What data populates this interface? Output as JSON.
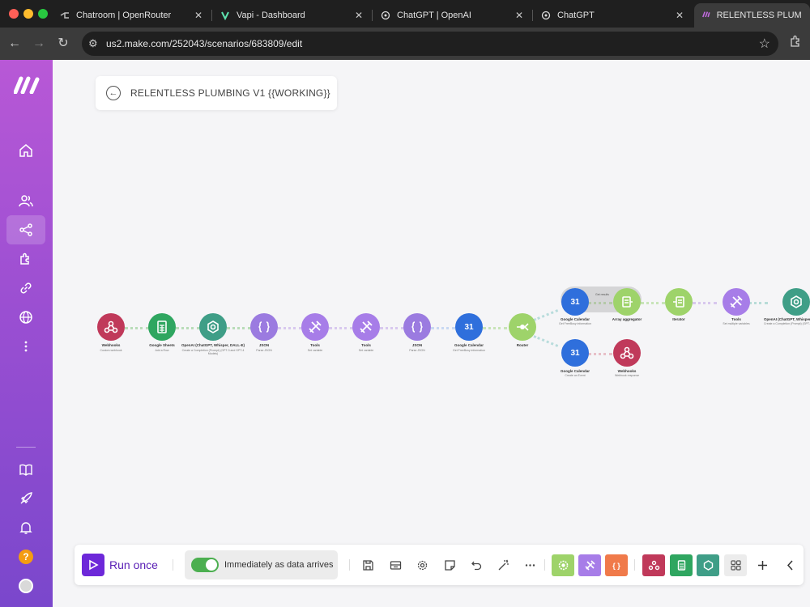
{
  "browser": {
    "tabs": [
      {
        "title": "Chatroom | OpenRouter",
        "icon": "openrouter-icon"
      },
      {
        "title": "Vapi - Dashboard",
        "icon": "vapi-icon"
      },
      {
        "title": "ChatGPT | OpenAI",
        "icon": "openai-icon"
      },
      {
        "title": "ChatGPT",
        "icon": "openai-icon"
      },
      {
        "title": "RELENTLESS PLUMBING",
        "icon": "make-icon",
        "active": true
      }
    ],
    "close_glyph": "✕",
    "url": "us2.make.com/252043/scenarios/683809/edit"
  },
  "sidebar": {
    "items": [
      {
        "name": "home",
        "icon": "home-icon"
      },
      {
        "name": "team",
        "icon": "users-icon"
      },
      {
        "name": "scenarios",
        "icon": "share-icon",
        "active": true
      },
      {
        "name": "apps",
        "icon": "puzzle-icon"
      },
      {
        "name": "connections",
        "icon": "link-icon"
      },
      {
        "name": "webhooks",
        "icon": "globe-icon"
      },
      {
        "name": "more",
        "icon": "more-vertical-icon"
      },
      {
        "name": "docs",
        "icon": "book-icon"
      },
      {
        "name": "whats-new",
        "icon": "rocket-icon"
      },
      {
        "name": "notifications",
        "icon": "bell-icon"
      },
      {
        "name": "help",
        "icon": "help-icon",
        "glyph": "?"
      },
      {
        "name": "profile",
        "icon": "avatar-icon"
      }
    ]
  },
  "scenario": {
    "name": "RELENTLESS PLUMBING V1  {{WORKING}}"
  },
  "flow": {
    "modules": [
      {
        "app": "Webhooks",
        "sub": "Custom webhook",
        "color": "#c0395a",
        "icon": "webhook-icon"
      },
      {
        "app": "Google Sheets",
        "sub": "Add a Row",
        "color": "#2fa660",
        "icon": "sheets-icon"
      },
      {
        "app": "OpenAI (ChatGPT, Whisper, DALL-E)",
        "sub": "Create a Completion (Prompt) (GPT-3 and GPT-4 Models)",
        "color": "#3f9e87",
        "icon": "openai-icon"
      },
      {
        "app": "JSON",
        "sub": "Parse JSON",
        "color": "#9b7be0",
        "icon": "json-icon"
      },
      {
        "app": "Tools",
        "sub": "Set variable",
        "color": "#a77de8",
        "icon": "tools-icon"
      },
      {
        "app": "Tools",
        "sub": "Set variable",
        "color": "#a77de8",
        "icon": "tools-icon"
      },
      {
        "app": "JSON",
        "sub": "Parse JSON",
        "color": "#9b7be0",
        "icon": "json-icon"
      },
      {
        "app": "Google Calendar",
        "sub": "Get FreeBusy information",
        "color": "#2f6fdc",
        "icon": "calendar-icon",
        "text": "31"
      },
      {
        "app": "Router",
        "sub": "",
        "color": "#9ed36a",
        "icon": "router-icon"
      },
      {
        "app": "Google Calendar",
        "sub": "Get FreeBusy information",
        "color": "#2f6fdc",
        "icon": "calendar-icon",
        "text": "31"
      },
      {
        "app": "Array aggregator",
        "sub": "",
        "color": "#9ed36a",
        "icon": "aggregator-icon"
      },
      {
        "app": "Iterator",
        "sub": "",
        "color": "#9ed36a",
        "icon": "iterator-icon"
      },
      {
        "app": "Tools",
        "sub": "Set multiple variables",
        "color": "#a77de8",
        "icon": "tools-icon"
      },
      {
        "app": "OpenAI (ChatGPT, Whisper,",
        "sub": "Create a Completion (Prompt) (GPT-3 and",
        "color": "#3f9e87",
        "icon": "openai-icon"
      },
      {
        "app": "Google Calendar",
        "sub": "Create an Event",
        "color": "#2f6fdc",
        "icon": "calendar-icon",
        "text": "31"
      },
      {
        "app": "Webhooks",
        "sub": "Webhook response",
        "color": "#c0395a",
        "icon": "webhook-icon"
      }
    ],
    "highlight_label": "Get results"
  },
  "bottom_toolbar": {
    "run_label": "Run once",
    "schedule_label": "Immediately as data arrives",
    "schedule_on": true,
    "tools": [
      "save-icon",
      "explain-flow-icon",
      "settings-icon",
      "notes-icon",
      "undo-icon",
      "magic-wand-icon",
      "more-icon"
    ],
    "tiles": [
      {
        "icon": "gear-tile-icon",
        "color": "#9ed36a"
      },
      {
        "icon": "tools-tile-icon",
        "color": "#a77de8"
      },
      {
        "icon": "text-tile-icon",
        "color": "#f07a4a",
        "text": "{ }"
      },
      {
        "icon": "webhook-tile-icon",
        "color": "#c0395a"
      },
      {
        "icon": "sheets-tile-icon",
        "color": "#2fa660"
      },
      {
        "icon": "openai-tile-icon",
        "color": "#3f9e87"
      },
      {
        "icon": "apps-grid-icon",
        "color": "#ececec"
      }
    ]
  }
}
